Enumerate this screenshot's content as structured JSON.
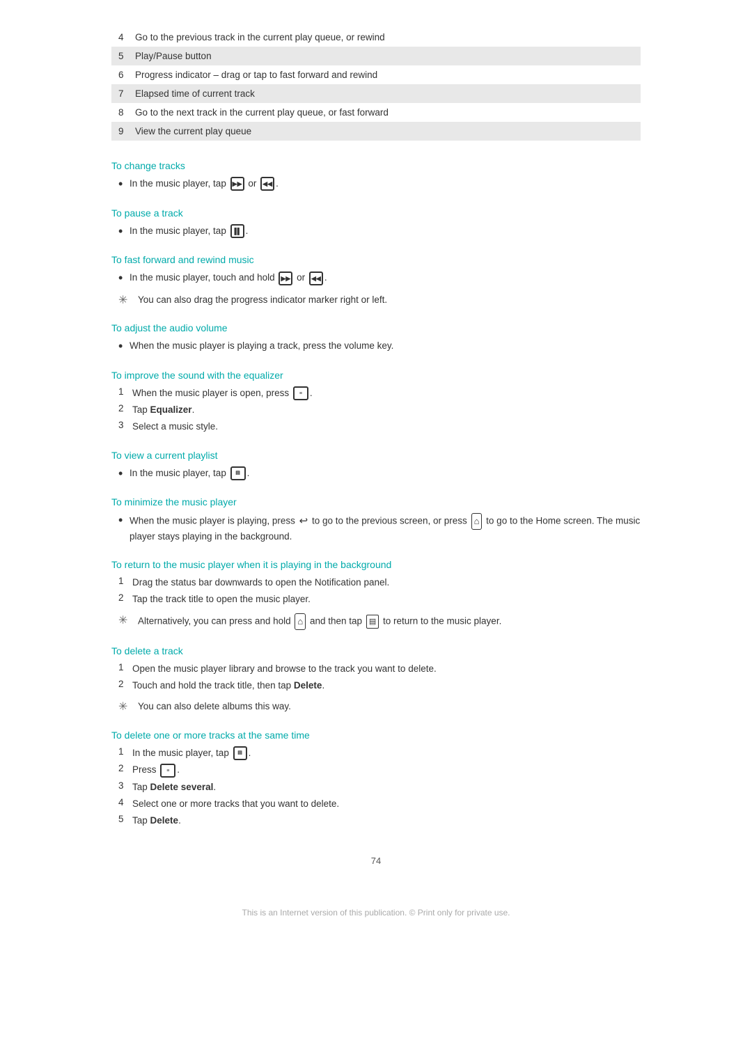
{
  "table": {
    "rows": [
      {
        "num": "4",
        "text": "Go to the previous track in the current play queue, or rewind",
        "shaded": false
      },
      {
        "num": "5",
        "text": "Play/Pause button",
        "shaded": true
      },
      {
        "num": "6",
        "text": "Progress indicator – drag or tap to fast forward and rewind",
        "shaded": false
      },
      {
        "num": "7",
        "text": "Elapsed time of current track",
        "shaded": true
      },
      {
        "num": "8",
        "text": "Go to the next track in the current play queue, or fast forward",
        "shaded": false
      },
      {
        "num": "9",
        "text": "View the current play queue",
        "shaded": true
      }
    ]
  },
  "sections": [
    {
      "heading": "To change tracks",
      "type": "bullet",
      "items": [
        {
          "text": "In the music player, tap [>>] or [<<]."
        }
      ]
    },
    {
      "heading": "To pause a track",
      "type": "bullet",
      "items": [
        {
          "text": "In the music player, tap [||]."
        }
      ]
    },
    {
      "heading": "To fast forward and rewind music",
      "type": "bullet_with_tip",
      "items": [
        {
          "text": "In the music player, touch and hold [>>] or [<<]."
        }
      ],
      "tip": "You can also drag the progress indicator marker right or left."
    },
    {
      "heading": "To adjust the audio volume",
      "type": "bullet",
      "items": [
        {
          "text": "When the music player is playing a track, press the volume key."
        }
      ]
    },
    {
      "heading": "To improve the sound with the equalizer",
      "type": "numbered",
      "items": [
        {
          "num": "1",
          "text": "When the music player is open, press [menu]."
        },
        {
          "num": "2",
          "text": "Tap Equalizer.",
          "bold_word": "Equalizer"
        },
        {
          "num": "3",
          "text": "Select a music style."
        }
      ]
    },
    {
      "heading": "To view a current playlist",
      "type": "bullet",
      "items": [
        {
          "text": "In the music player, tap [playlist]."
        }
      ]
    },
    {
      "heading": "To minimize the music player",
      "type": "bullet",
      "items": [
        {
          "text": "When the music player is playing, press [back] to go to the previous screen, or press [home] to go to the Home screen. The music player stays playing in the background.",
          "has_home": true
        }
      ]
    },
    {
      "heading": "To return to the music player when it is playing in the background",
      "type": "numbered_with_tip",
      "items": [
        {
          "num": "1",
          "text": "Drag the status bar downwards to open the Notification panel."
        },
        {
          "num": "2",
          "text": "Tap the track title to open the music player."
        }
      ],
      "tip": "Alternatively, you can press and hold [home] and then tap [recent] to return to the music player."
    },
    {
      "heading": "To delete a track",
      "type": "numbered_with_tip",
      "items": [
        {
          "num": "1",
          "text": "Open the music player library and browse to the track you want to delete."
        },
        {
          "num": "2",
          "text": "Touch and hold the track title, then tap Delete.",
          "bold_word": "Delete"
        }
      ],
      "tip": "You can also delete albums this way."
    },
    {
      "heading": "To delete one or more tracks at the same time",
      "type": "numbered",
      "items": [
        {
          "num": "1",
          "text": "In the music player, tap [multi]."
        },
        {
          "num": "2",
          "text": "Press [menu]."
        },
        {
          "num": "3",
          "text": "Tap Delete several.",
          "bold_word": "Delete several"
        },
        {
          "num": "4",
          "text": "Select one or more tracks that you want to delete."
        },
        {
          "num": "5",
          "text": "Tap Delete.",
          "bold_word": "Delete"
        }
      ]
    }
  ],
  "page_number": "74",
  "footer_text": "This is an Internet version of this publication. © Print only for private use."
}
